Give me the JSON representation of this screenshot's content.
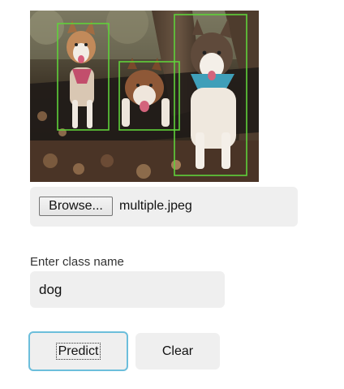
{
  "image": {
    "description_icon": "dogs-photo",
    "detection_box_color": "#5fd13a",
    "detections": 3
  },
  "file_picker": {
    "browse_label": "Browse...",
    "file_name": "multiple.jpeg"
  },
  "class_field": {
    "label": "Enter class name",
    "value": "dog"
  },
  "actions": {
    "predict_label": "Predict",
    "clear_label": "Clear",
    "focus_color": "#6cbedb"
  }
}
